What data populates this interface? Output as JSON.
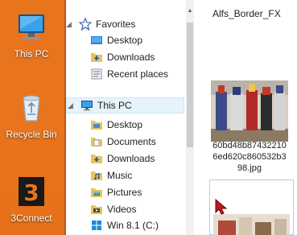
{
  "desktop": {
    "icons": [
      {
        "label": "This PC",
        "icon": "computer-icon"
      },
      {
        "label": "Recycle Bin",
        "icon": "recycle-bin-icon"
      },
      {
        "label": "3Connect",
        "icon": "3connect-app-icon"
      }
    ]
  },
  "nav": {
    "favorites_header": "Favorites",
    "favorites": [
      {
        "label": "Desktop",
        "icon": "desktop-folder-icon"
      },
      {
        "label": "Downloads",
        "icon": "downloads-folder-icon"
      },
      {
        "label": "Recent places",
        "icon": "recent-places-icon"
      }
    ],
    "thispc_header": "This PC",
    "thispc": [
      {
        "label": "Desktop",
        "icon": "desktop-folder-icon"
      },
      {
        "label": "Documents",
        "icon": "documents-folder-icon"
      },
      {
        "label": "Downloads",
        "icon": "downloads-folder-icon"
      },
      {
        "label": "Music",
        "icon": "music-folder-icon"
      },
      {
        "label": "Pictures",
        "icon": "pictures-folder-icon"
      },
      {
        "label": "Videos",
        "icon": "videos-folder-icon"
      },
      {
        "label": "Win 8.1 (C:)",
        "icon": "windows-drive-icon"
      }
    ]
  },
  "content": {
    "folder_title": "Alfs_Border_FX",
    "file": {
      "name_lines": [
        "60bd48b87432210",
        "6ed620c860532b3",
        "98.jpg"
      ]
    }
  },
  "colors": {
    "desktop_bg": "#e8741c",
    "selection_bg": "#e5f3fb",
    "selection_border": "#cde8f7"
  }
}
